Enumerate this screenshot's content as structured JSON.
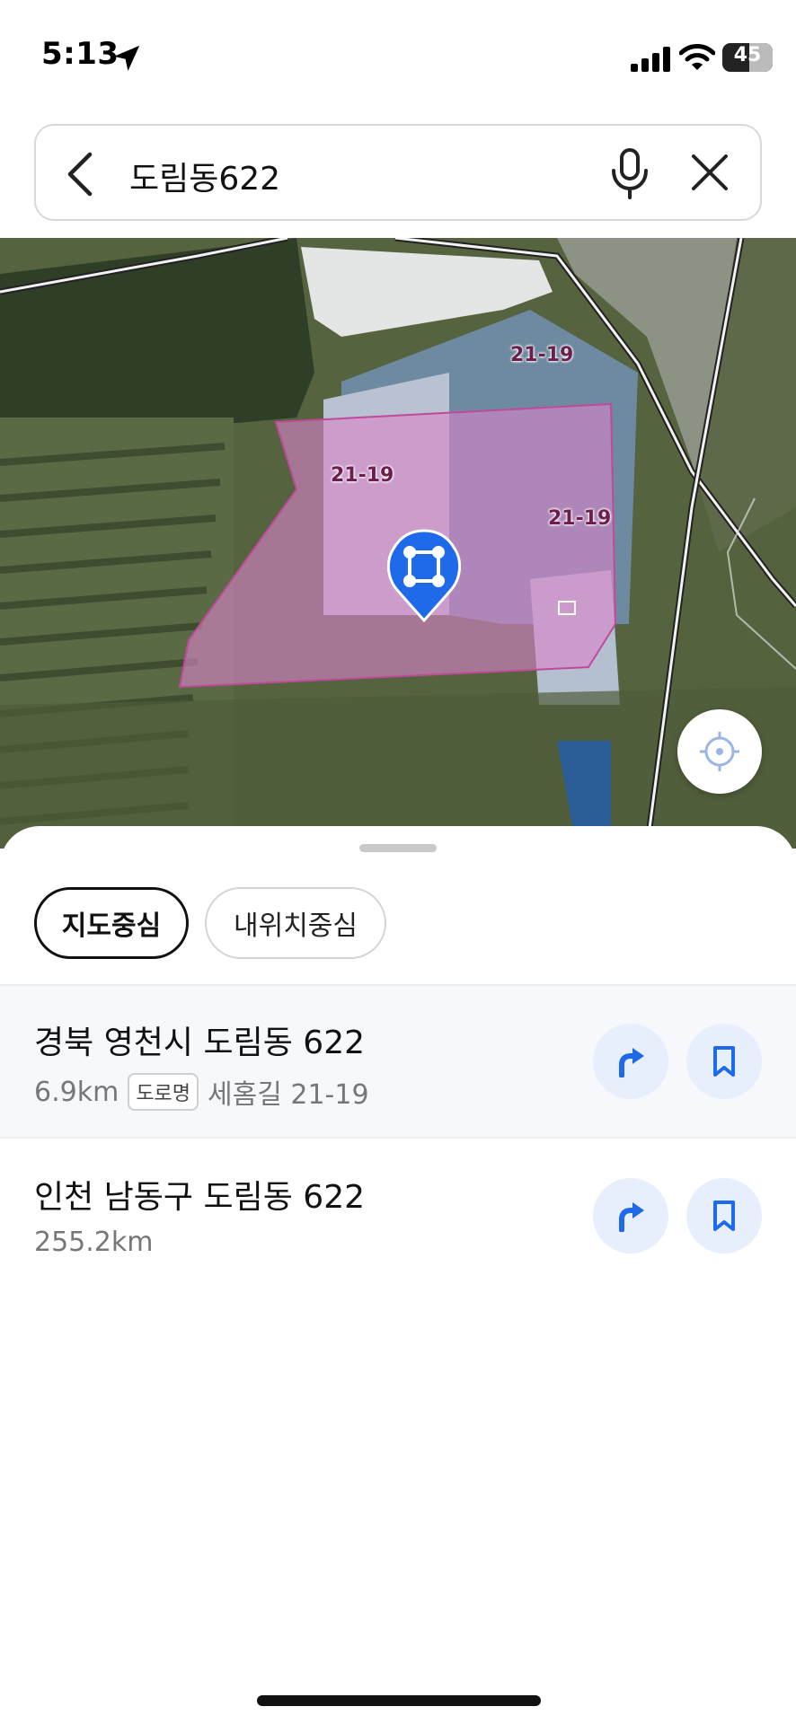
{
  "status_bar": {
    "time": "5:13",
    "battery": "45",
    "battery_level": 0.45,
    "icons": [
      "location-arrow-icon",
      "cellular-signal-icon",
      "wifi-icon",
      "battery-icon"
    ]
  },
  "search": {
    "query": "도림동622",
    "icons": [
      "back-arrow-icon",
      "microphone-icon",
      "clear-x-icon"
    ]
  },
  "map": {
    "parcel_labels": [
      "21-19",
      "21-19",
      "21-19"
    ],
    "pin_icon": "land-parcel-pin-icon",
    "gps_icon": "crosshair-locate-icon",
    "parcel_color": "#d985c8",
    "pin_color": "#1e6ae8"
  },
  "filters": {
    "map_center": "지도중심",
    "my_location_center": "내위치중심"
  },
  "results": [
    {
      "title": "경북 영천시 도림동 622",
      "distance": "6.9km",
      "road_badge": "도로명",
      "road_address": "세홈길 21-19"
    },
    {
      "title": "인천 남동구 도림동 622",
      "distance": "255.2km"
    }
  ],
  "colors": {
    "accent": "#1e6ae8",
    "action_bg": "#e8effc",
    "selected_row_bg": "#f6f8fc"
  }
}
